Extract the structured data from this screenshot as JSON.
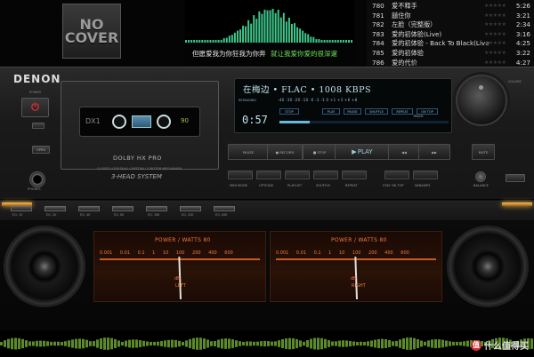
{
  "cover": {
    "line1": "NO",
    "line2": "COVER"
  },
  "lyrics": {
    "current": "但愿爱我为你狂我为你奔",
    "next": "就让我爱你爱的很深邃"
  },
  "playlist": [
    {
      "num": "780",
      "title": "爱不释手",
      "duration": "5:26"
    },
    {
      "num": "781",
      "title": "囍住你",
      "duration": "3:21"
    },
    {
      "num": "782",
      "title": "左脸（完整版）",
      "duration": "2:34"
    },
    {
      "num": "783",
      "title": "爱的初体验(Live)",
      "duration": "3:16"
    },
    {
      "num": "784",
      "title": "爱的初体验 - Back To Black(Live)",
      "duration": "4:25"
    },
    {
      "num": "785",
      "title": "爱的初体验",
      "duration": "3:22"
    },
    {
      "num": "786",
      "title": "爱的代价",
      "duration": "4:27"
    }
  ],
  "deck": {
    "brand": "DENON",
    "power_label": "POWER",
    "open_label": "OPEN",
    "phones_label": "PHONES",
    "cassette": {
      "brand": "DX1",
      "length": "90",
      "dolby": "DOLBY HX PRO",
      "closed": "CLOSED LOOP  DUAL CAPSTAN / 3 MOTOR MECHANISM",
      "head": "3-HEAD SYSTEM"
    },
    "volume_label": "VOLUME",
    "balance_label": "BALANCE"
  },
  "display": {
    "track": "在梅边 • FLAC • 1008 KBPS",
    "remaining_label": "REMAINING",
    "scale": "-40  -30  -20  -10  -6  -3  -1  0  +1  +3  +6  +8",
    "time": "0:57",
    "modes": [
      "STOP",
      "PLAY",
      "PAUSE",
      "SHUFFLE",
      "REPEAT",
      "ON TOP"
    ],
    "track_label": "TRACK",
    "progress": 0.18
  },
  "transport": [
    {
      "label": "PAUSE",
      "caption": "MINI MODE"
    },
    {
      "label": "● RECORD",
      "caption": "OPTIONS"
    },
    {
      "label": "■ STOP",
      "caption": "PLAYLIST"
    },
    {
      "label": "PLAY",
      "caption": "SHUFFLE"
    },
    {
      "label": "◀◀",
      "caption": "REPEAT"
    },
    {
      "label": "▶▶",
      "caption": "STAY ON TOP"
    },
    {
      "label": "MUTE",
      "caption": "WINAMP3"
    }
  ],
  "eq": [
    "EQ. 1K",
    "EQ. 2K",
    "EQ. 4K",
    "EQ. 8K",
    "EQ. 16K",
    "EQ. 32K",
    "EQ. 64K"
  ],
  "meters": [
    {
      "title": "POWER / WATTS  80",
      "scale": "0.001 0.01 0.1 1 10 100 200 400 600",
      "db": "dB",
      "side": "LEFT"
    },
    {
      "title": "POWER / WATTS  80",
      "scale": "0.001 0.01 0.1 1 10 100 200 400 600",
      "db": "dB",
      "side": "RIGHT"
    }
  ],
  "watermark": "什么值得买",
  "colors": {
    "accent": "#f07a3a",
    "display": "#bfe4ec",
    "viz": "#3cc68a",
    "lyric_next": "#6ee05a"
  }
}
